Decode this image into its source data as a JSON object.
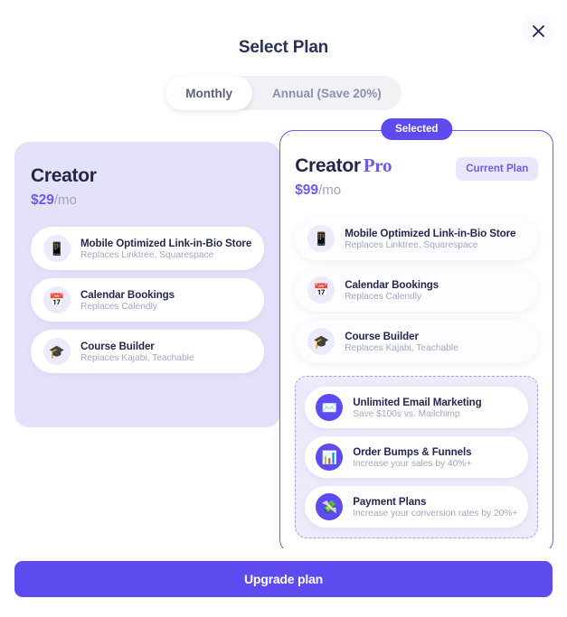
{
  "header": {
    "title": "Select Plan",
    "close_icon": "close-icon"
  },
  "billing_toggle": {
    "options": [
      {
        "label": "Monthly",
        "active": true
      },
      {
        "label": "Annual (Save 20%)",
        "active": false
      }
    ]
  },
  "plans": [
    {
      "name": "Creator",
      "price_amount": "$29",
      "price_period": "/mo",
      "selected": false,
      "features": [
        {
          "icon": "mobile-phone-icon",
          "glyph": "📱",
          "title": "Mobile Optimized Link-in-Bio Store",
          "subtitle": "Replaces Linktree, Squarespace"
        },
        {
          "icon": "calendar-icon",
          "glyph": "📅",
          "title": "Calendar Bookings",
          "subtitle": "Replaces Calendly"
        },
        {
          "icon": "graduation-cap-icon",
          "glyph": "🎓",
          "title": "Course Builder",
          "subtitle": "Replaces Kajabi, Teachable"
        }
      ]
    },
    {
      "name": "Creator",
      "name_suffix": "Pro",
      "price_amount": "$99",
      "price_period": "/mo",
      "selected": true,
      "selected_badge": "Selected",
      "current_plan_label": "Current Plan",
      "features": [
        {
          "icon": "mobile-phone-icon",
          "glyph": "📱",
          "title": "Mobile Optimized Link-in-Bio Store",
          "subtitle": "Replaces Linktree, Squarespace"
        },
        {
          "icon": "calendar-icon",
          "glyph": "📅",
          "title": "Calendar Bookings",
          "subtitle": "Replaces Calendly"
        },
        {
          "icon": "graduation-cap-icon",
          "glyph": "🎓",
          "title": "Course Builder",
          "subtitle": "Replaces Kajabi, Teachable"
        }
      ],
      "bonus_features": [
        {
          "icon": "envelope-icon",
          "glyph": "✉️",
          "title": "Unlimited Email Marketing",
          "subtitle": "Save $100s vs. Mailchimp"
        },
        {
          "icon": "bar-chart-icon",
          "glyph": "📊",
          "title": "Order Bumps & Funnels",
          "subtitle": "Increase your sales by 40%+"
        },
        {
          "icon": "money-with-wings-icon",
          "glyph": "💸",
          "title": "Payment Plans",
          "subtitle": "Increase your conversion rates by 20%+"
        }
      ]
    }
  ],
  "footer": {
    "upgrade_label": "Upgrade plan"
  },
  "colors": {
    "accent": "#5d4bf0",
    "accent_alt": "#6c5ce7",
    "card_basic_bg": "#e4e2fa",
    "pill_bg": "#e9e7fd",
    "title_text": "#232853",
    "muted_text": "#a3a7c2"
  }
}
